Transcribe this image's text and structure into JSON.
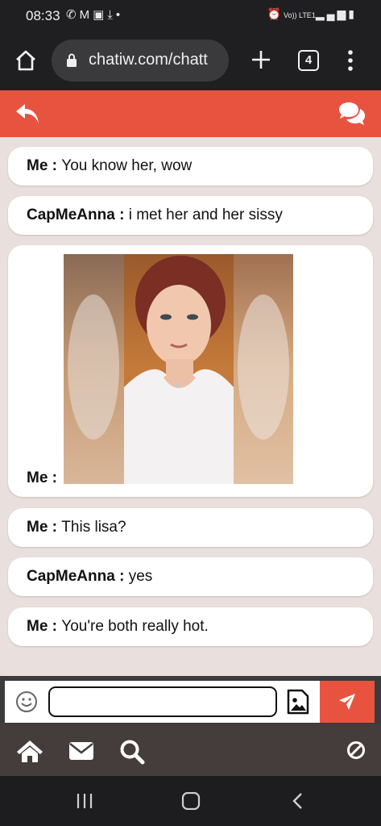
{
  "status_bar": {
    "time": "08:33",
    "left_icons": [
      "whatsapp-icon",
      "gmail-icon",
      "gallery-icon",
      "download-icon",
      "dot"
    ],
    "right_icons": [
      "alarm-icon",
      "wifi-icon",
      "volte-icon",
      "signal-icon",
      "battery-icon"
    ],
    "network_label": "Vo)) LTE1"
  },
  "browser": {
    "url": "chatiw.com/chatt",
    "tab_count": "4"
  },
  "messages": [
    {
      "sender": "Me",
      "separator": " : ",
      "text": "You know her, wow"
    },
    {
      "sender": "CapMeAnna",
      "separator": " : ",
      "text": "i met her and her sissy"
    },
    {
      "sender": "Me",
      "separator": " : ",
      "type": "image"
    },
    {
      "sender": "Me",
      "separator": " : ",
      "text": "This lisa?"
    },
    {
      "sender": "CapMeAnna",
      "separator": " : ",
      "text": "yes"
    },
    {
      "sender": "Me",
      "separator": " : ",
      "text": "You're both really hot."
    }
  ],
  "composer": {
    "input_value": "",
    "input_placeholder": ""
  },
  "colors": {
    "accent": "#e8533f",
    "chat_background": "#e9dfdd",
    "nav_background": "#443d3b"
  }
}
